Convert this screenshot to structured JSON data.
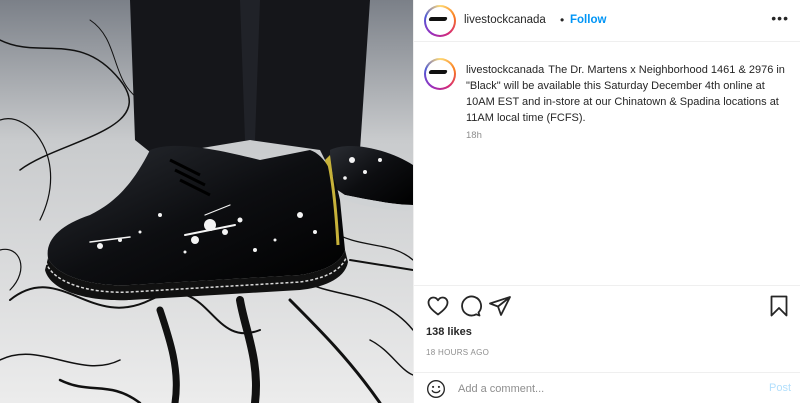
{
  "post": {
    "image_alt": "Dr. Martens shoes with white paint splatter",
    "header": {
      "username": "livestockcanada",
      "separator": "•",
      "follow_label": "Follow",
      "more_icon": "more-horizontal-icon"
    },
    "caption": {
      "username": "livestockcanada",
      "text": "The Dr. Martens x Neighborhood 1461 & 2976 in \"Black\" will be available this Saturday December 4th online at 10AM EST and in-store at our Chinatown & Spadina locations at 11AM local time (FCFS).",
      "time": "18h"
    },
    "actions": {
      "like_icon": "heart-icon",
      "comment_icon": "comment-icon",
      "share_icon": "share-icon",
      "save_icon": "bookmark-icon"
    },
    "likes": "138 likes",
    "timestamp": "18 HOURS AGO",
    "comment_box": {
      "placeholder": "Add a comment...",
      "post_label": "Post",
      "emoji_icon": "emoji-icon"
    },
    "colors": {
      "link_blue": "#0095f6",
      "post_disabled": "#b2dffc",
      "muted": "#8e8e8e",
      "text": "#262626"
    }
  }
}
